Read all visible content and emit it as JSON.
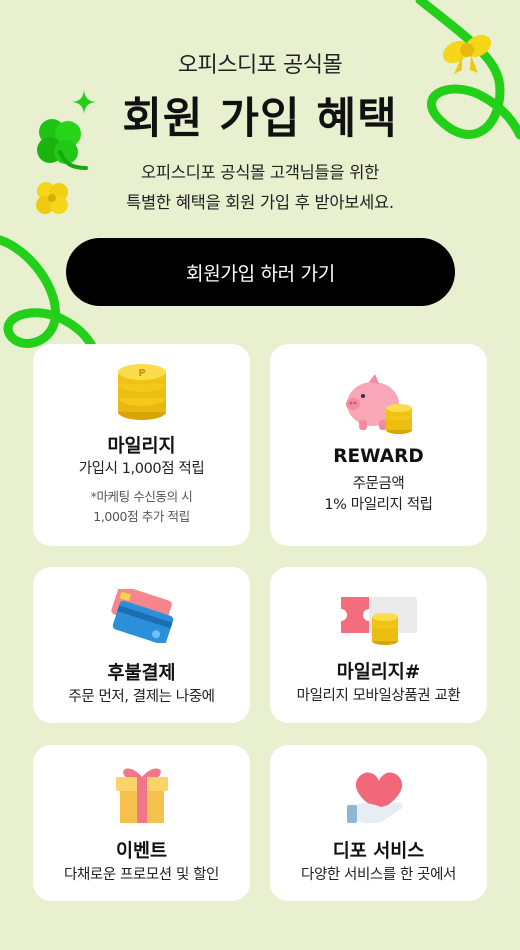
{
  "header": {
    "subtitle": "오피스디포 공식몰",
    "title": "회원 가입 혜택",
    "description_line1": "오피스디포 공식몰 고객님들을 위한",
    "description_line2": "특별한 혜택을 회원 가입 후 받아보세요."
  },
  "cta": {
    "label": "회원가입 하러 가기"
  },
  "cards": [
    {
      "title": "마일리지",
      "desc": "가입시 1,000점 적립",
      "note_line1": "*마케팅 수신동의 시",
      "note_line2": "1,000점 추가 적립",
      "icon": "coin-stack-icon"
    },
    {
      "title": "REWARD",
      "desc_line1": "주문금액",
      "desc_line2": "1% 마일리지 적립",
      "icon": "piggy-bank-icon"
    },
    {
      "title": "후불결제",
      "desc": "주문 먼저, 결제는 나중에",
      "icon": "credit-cards-icon"
    },
    {
      "title": "마일리지#",
      "desc": "마일리지 모바일상품권 교환",
      "icon": "gift-voucher-icon"
    },
    {
      "title": "이벤트",
      "desc": "다채로운 프로모션 및 할인",
      "icon": "gift-box-icon"
    },
    {
      "title": "디포 서비스",
      "desc": "다양한 서비스를 한 곳에서",
      "icon": "hand-heart-icon"
    }
  ],
  "colors": {
    "background": "#e8f0d0",
    "accent_green": "#22d01a",
    "cta_bg": "#000000",
    "card_bg": "#ffffff",
    "coin_gold": "#f5c518"
  }
}
